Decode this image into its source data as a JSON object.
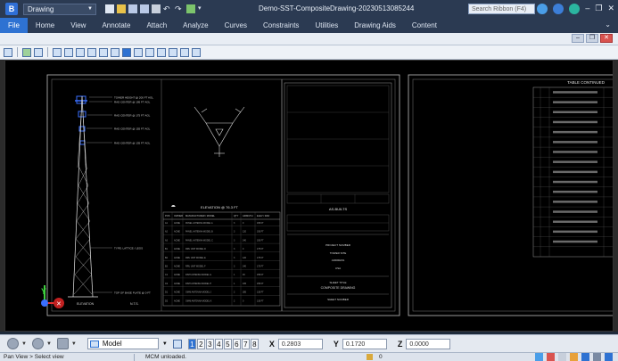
{
  "app": {
    "icon_letter": "B",
    "workspace": "Drawing",
    "document_title": "Demo-SST-CompositeDrawing-20230513085244",
    "search_placeholder": "Search Ribbon (F4)"
  },
  "ribbon": {
    "tabs": [
      {
        "label": "File",
        "active": true
      },
      {
        "label": "Home"
      },
      {
        "label": "View"
      },
      {
        "label": "Annotate"
      },
      {
        "label": "Attach"
      },
      {
        "label": "Analyze"
      },
      {
        "label": "Curves"
      },
      {
        "label": "Constraints"
      },
      {
        "label": "Utilities"
      },
      {
        "label": "Drawing Aids"
      },
      {
        "label": "Content"
      }
    ]
  },
  "drawing": {
    "sheet_left": {
      "callouts": [
        "TOWER HEIGHT @ 200 FT AGL",
        "RAD CENTER @ 195 FT AGL",
        "RAD CENTER @ 175 FT AGL",
        "RAD CENTER @ 155 FT AGL",
        "RAD CENTER @ 135 FT AGL",
        "TYPE: LATTICE / LEGS",
        "TOP OF BASE PLATE @ 0 FT"
      ],
      "elevation_label": "ELEVATION",
      "nts_label": "N.T.S.",
      "plan_title": "ELEVATION @ 76.3 FT",
      "table_header": [
        "POS",
        "OWNER",
        "MANUFACTURER / MODEL",
        "QTY",
        "AZIMUTH",
        "ELEV / RAD"
      ],
      "table_rows": [
        [
          "A1",
          "ACME",
          "PANEL ANTENNA MODEL A",
          "3",
          "0",
          "195 FT"
        ],
        [
          "A2",
          "ACME",
          "PANEL ANTENNA MODEL B",
          "3",
          "120",
          "195 FT"
        ],
        [
          "A3",
          "ACME",
          "PANEL ANTENNA MODEL C",
          "3",
          "240",
          "195 FT"
        ],
        [
          "B1",
          "ACME",
          "RRU UNIT MODEL D",
          "3",
          "0",
          "175 FT"
        ],
        [
          "B2",
          "ACME",
          "RRU UNIT MODEL E",
          "3",
          "120",
          "175 FT"
        ],
        [
          "B3",
          "ACME",
          "RRU UNIT MODEL F",
          "3",
          "240",
          "175 FT"
        ],
        [
          "C1",
          "ACME",
          "DISH ANTENNA MODEL G",
          "1",
          "45",
          "155 FT"
        ],
        [
          "C2",
          "ACME",
          "DISH ANTENNA MODEL H",
          "1",
          "165",
          "155 FT"
        ],
        [
          "D1",
          "ACME",
          "OMNI ANTENNA MODEL J",
          "2",
          "285",
          "135 FT"
        ],
        [
          "D2",
          "ACME",
          "OMNI ANTENNA MODEL K",
          "2",
          "0",
          "135 FT"
        ]
      ],
      "title_block": {
        "as_built": "AS-BUILTS",
        "project_number": "PROJECT NUMBER",
        "project_label": "TOWER SITE",
        "address_label": "ADDRESS",
        "country": "USA",
        "sheet_title": "SHEET TITLE",
        "drawing_title": "COMPOSITE DRAWING",
        "sheet_number": "SHEET NUMBER"
      }
    },
    "sheet_right": {
      "title": "TABLE CONTINUED",
      "rows": 16
    }
  },
  "bottom_bar": {
    "model_name": "Model",
    "view_numbers": [
      "1",
      "2",
      "3",
      "4",
      "5",
      "6",
      "7",
      "8"
    ],
    "active_view": "1",
    "x_label": "X",
    "x_value": "0.2803",
    "y_label": "Y",
    "y_value": "0.1720",
    "z_label": "Z",
    "z_value": "0.0000"
  },
  "status_bar": {
    "prompt": "Pan View > Select view",
    "message": "MCM unloaded.",
    "counter": "0"
  }
}
